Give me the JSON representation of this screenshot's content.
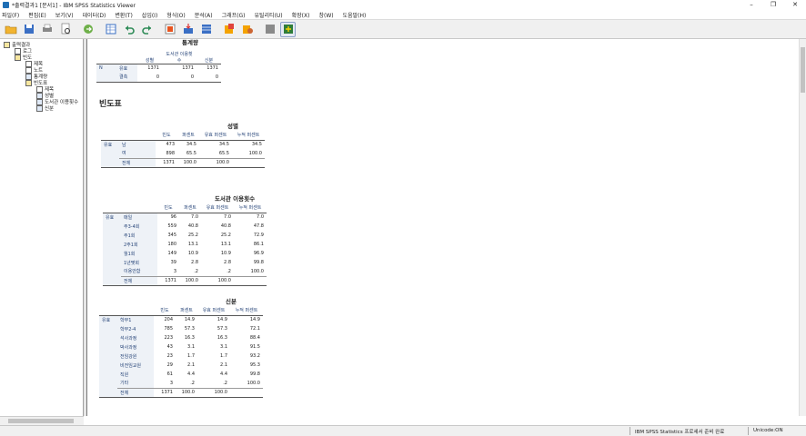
{
  "window": {
    "title": "*출력결과1 [문서1] - IBM SPSS Statistics Viewer",
    "minimize": "–",
    "maximize": "❐",
    "close": "✕"
  },
  "menu": [
    "파일(F)",
    "편집(E)",
    "보기(V)",
    "데이터(D)",
    "변환(T)",
    "삽입(I)",
    "형식(O)",
    "분석(A)",
    "그래프(G)",
    "유틸리티(U)",
    "확장(X)",
    "창(W)",
    "도움말(H)"
  ],
  "toolbar_icons": [
    "open-folder-icon",
    "save-icon",
    "print-icon",
    "print-preview-icon",
    "export-icon",
    "goto-data-icon",
    "undo-icon",
    "redo-icon",
    "goto-case-icon",
    "goto-variable-icon",
    "variables-icon",
    "insert-table-icon",
    "select-last-output-icon",
    "designate-window-icon",
    "show-all-icon",
    "hide-icon",
    "promote-icon"
  ],
  "outline": [
    "출력결과",
    "로그",
    "빈도",
    "제목",
    "노트",
    "통계량",
    "빈도표",
    "제목",
    "성별",
    "도서관 이용횟수",
    "신분"
  ],
  "doc": {
    "stats_title": "통계량",
    "stats": {
      "cols": [
        "성별",
        "도서관 이용횟수",
        "신분"
      ],
      "n": "N",
      "rows": [
        {
          "label": "유효",
          "values": [
            "1371",
            "1371",
            "1371"
          ]
        },
        {
          "label": "결측",
          "values": [
            "0",
            "0",
            "0"
          ]
        }
      ]
    },
    "freq_heading": "빈도표",
    "headers": [
      "빈도",
      "퍼센트",
      "유효 퍼센트",
      "누적 퍼센트"
    ],
    "valid": "유효",
    "tables": [
      {
        "title": "성별",
        "rows": [
          [
            "남",
            "473",
            "34.5",
            "34.5",
            "34.5"
          ],
          [
            "여",
            "898",
            "65.5",
            "65.5",
            "100.0"
          ]
        ],
        "total": [
          "전체",
          "1371",
          "100.0",
          "100.0"
        ]
      },
      {
        "title": "도서관 이용횟수",
        "rows": [
          [
            "매일",
            "96",
            "7.0",
            "7.0",
            "7.0"
          ],
          [
            "주3-4회",
            "559",
            "40.8",
            "40.8",
            "47.8"
          ],
          [
            "주1회",
            "345",
            "25.2",
            "25.2",
            "72.9"
          ],
          [
            "2주1회",
            "180",
            "13.1",
            "13.1",
            "86.1"
          ],
          [
            "월1회",
            "149",
            "10.9",
            "10.9",
            "96.9"
          ],
          [
            "1년몇회",
            "39",
            "2.8",
            "2.8",
            "99.8"
          ],
          [
            "이용안함",
            "3",
            ".2",
            ".2",
            "100.0"
          ]
        ],
        "total": [
          "전체",
          "1371",
          "100.0",
          "100.0"
        ]
      },
      {
        "title": "신분",
        "rows": [
          [
            "학부1",
            "204",
            "14.9",
            "14.9",
            "14.9"
          ],
          [
            "학부2-4",
            "785",
            "57.3",
            "57.3",
            "72.1"
          ],
          [
            "석사과정",
            "223",
            "16.3",
            "16.3",
            "88.4"
          ],
          [
            "박사과정",
            "43",
            "3.1",
            "3.1",
            "91.5"
          ],
          [
            "전임강원",
            "23",
            "1.7",
            "1.7",
            "93.2"
          ],
          [
            "비전임교원",
            "29",
            "2.1",
            "2.1",
            "95.3"
          ],
          [
            "직원",
            "61",
            "4.4",
            "4.4",
            "99.8"
          ],
          [
            "기타",
            "3",
            ".2",
            ".2",
            "100.0"
          ]
        ],
        "total": [
          "전체",
          "1371",
          "100.0",
          "100.0"
        ]
      }
    ]
  },
  "status": {
    "processor": "IBM SPSS Statistics 프로세서 준비 완료",
    "unicode": "Unicode:ON"
  }
}
